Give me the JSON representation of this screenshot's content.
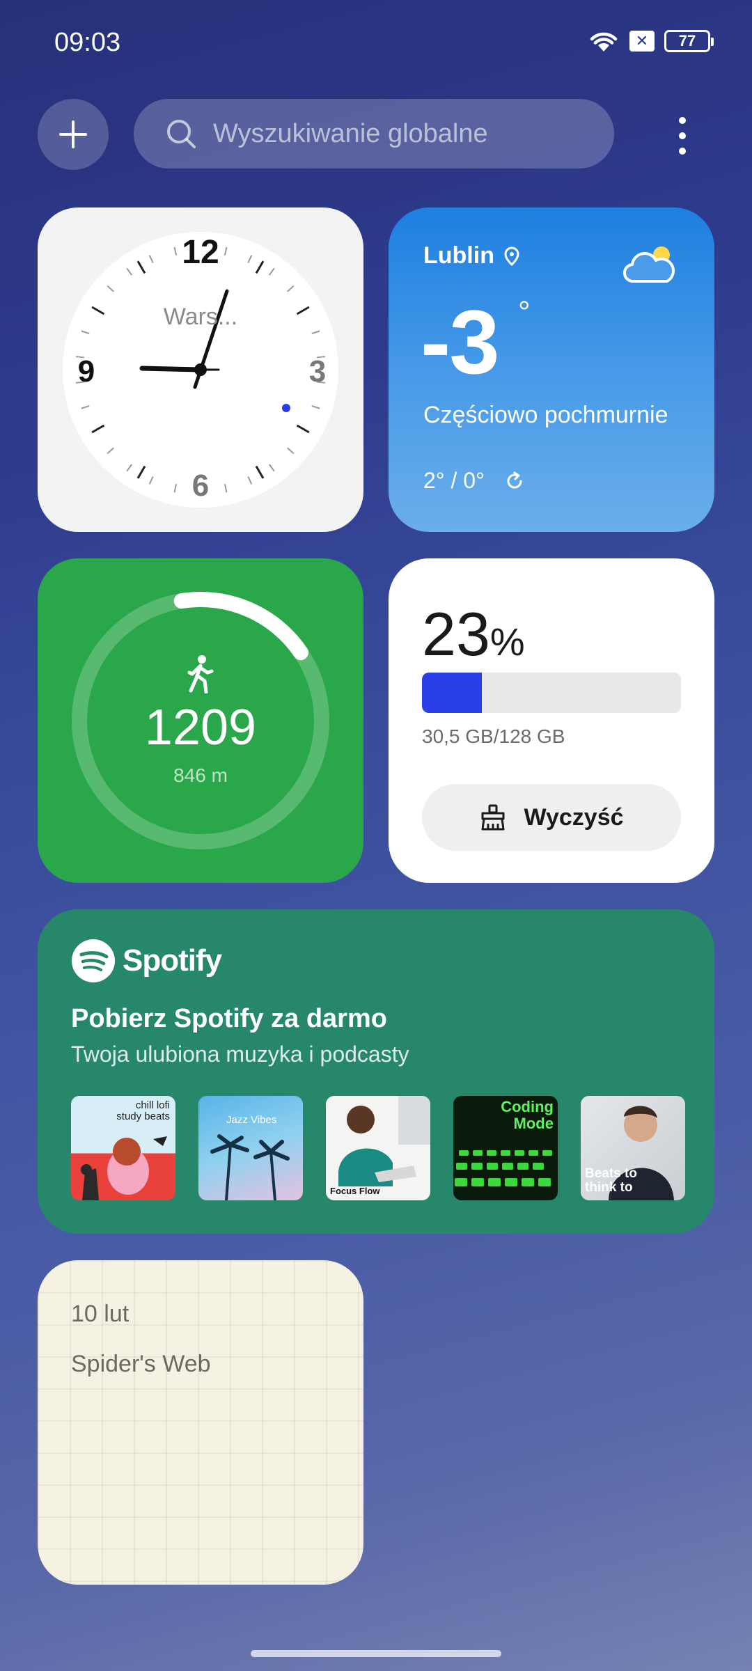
{
  "status_bar": {
    "time": "09:03",
    "battery": "77"
  },
  "search": {
    "placeholder": "Wyszukiwanie globalne"
  },
  "clock": {
    "city": "Wars...",
    "numerals": [
      "12",
      "3",
      "6",
      "9"
    ]
  },
  "weather": {
    "city": "Lublin",
    "temperature": "-3",
    "degree": "°",
    "description": "Częściowo pochmurnie",
    "range": "2° / 0°"
  },
  "steps": {
    "count": "1209",
    "distance": "846 m",
    "progress": 0.18
  },
  "storage": {
    "percent": "23",
    "percent_sign": "%",
    "used_fraction": 0.23,
    "used_text": "30,5 GB/128 GB",
    "clean_label": "Wyczyść"
  },
  "spotify": {
    "wordmark": "Spotify",
    "title": "Pobierz Spotify za darmo",
    "subtitle": "Twoja ulubiona muzyka i podcasty",
    "playlists": [
      {
        "label": "chill lofi study beats"
      },
      {
        "label": "Jazz Vibes"
      },
      {
        "label": "Focus Flow"
      },
      {
        "label": "Coding Mode"
      },
      {
        "label": "Beats to think to"
      }
    ]
  },
  "note": {
    "date": "10 lut",
    "text": "Spider's Web"
  },
  "icons": [
    "wifi-icon",
    "sim-icon",
    "battery-icon",
    "plus-icon",
    "search-icon",
    "more-icon",
    "location-pin-icon",
    "cloud-sun-icon",
    "refresh-icon",
    "walking-icon",
    "broom-icon",
    "spotify-logo-icon"
  ]
}
